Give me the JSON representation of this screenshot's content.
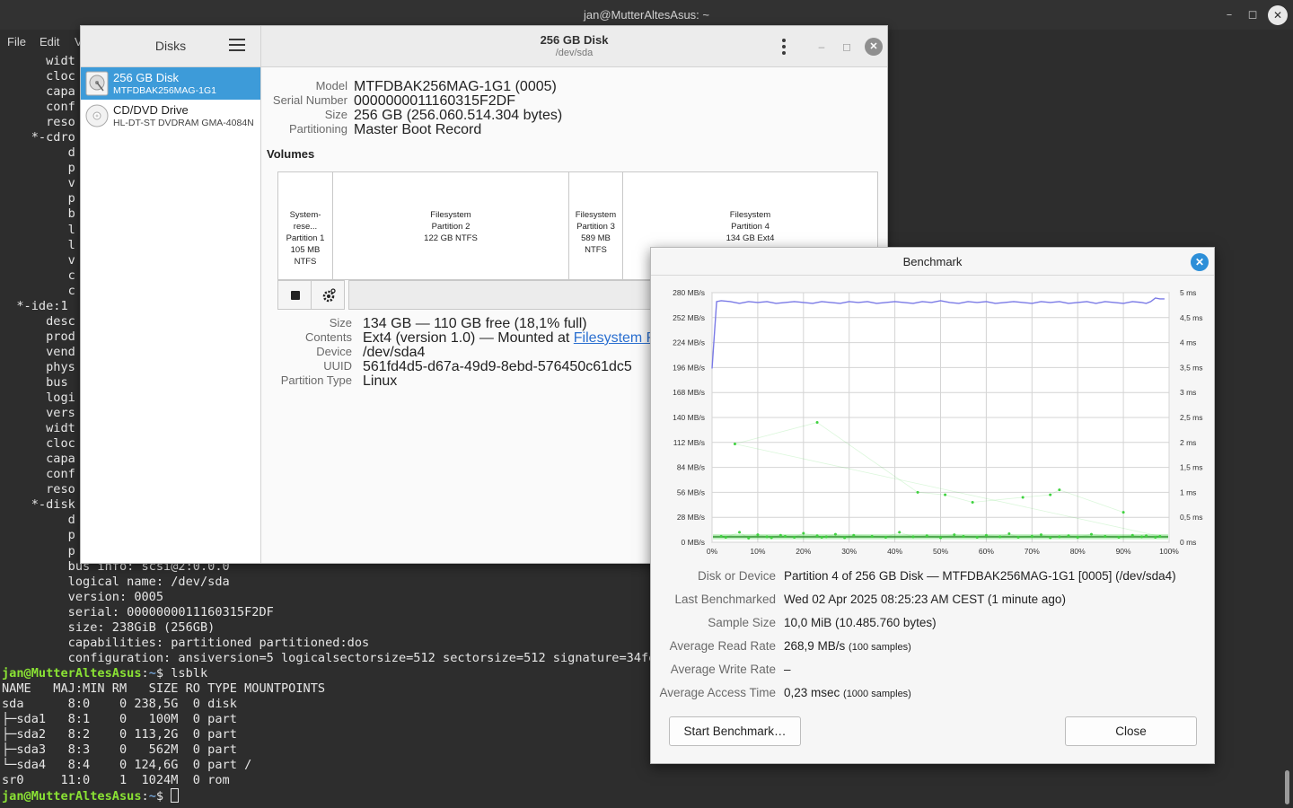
{
  "terminal": {
    "title": "jan@MutterAltesAsus: ~",
    "menu": [
      "File",
      "Edit",
      "V"
    ],
    "lines": [
      {
        "text": "      widt"
      },
      {
        "text": "      cloc"
      },
      {
        "text": "      capa"
      },
      {
        "text": "      conf"
      },
      {
        "text": "      reso"
      },
      {
        "text": "    *-cdro"
      },
      {
        "text": "         d"
      },
      {
        "text": "         p"
      },
      {
        "text": "         v"
      },
      {
        "text": "         p"
      },
      {
        "text": "         b"
      },
      {
        "text": "         l"
      },
      {
        "text": "         l"
      },
      {
        "text": "         v"
      },
      {
        "text": "         c"
      },
      {
        "text": "         c"
      },
      {
        "text": "  *-ide:1"
      },
      {
        "text": "      desc"
      },
      {
        "text": "      prod"
      },
      {
        "text": "      vend"
      },
      {
        "text": "      phys"
      },
      {
        "text": "      bus"
      },
      {
        "text": "      logi"
      },
      {
        "text": "      vers"
      },
      {
        "text": "      widt"
      },
      {
        "text": "      cloc"
      },
      {
        "text": "      capa"
      },
      {
        "text": "      conf"
      },
      {
        "text": "      reso"
      },
      {
        "text": "    *-disk"
      },
      {
        "text": "         d"
      },
      {
        "text": "         p"
      },
      {
        "text": "         p"
      },
      {
        "text": "         bus info: scsi@2:0.0.0"
      },
      {
        "text": "         logical name: /dev/sda"
      },
      {
        "text": "         version: 0005"
      },
      {
        "text": "         serial: 0000000011160315F2DF"
      },
      {
        "text": "         size: 238GiB (256GB)"
      },
      {
        "text": "         capabilities: partitioned partitioned:dos"
      },
      {
        "text": "         configuration: ansiversion=5 logicalsectorsize=512 sectorsize=512 signature=34fe3"
      },
      {
        "user": "jan@MutterAltesAsus",
        "path": "~",
        "cmd": "$ lsblk"
      },
      {
        "text": "NAME   MAJ:MIN RM   SIZE RO TYPE MOUNTPOINTS"
      },
      {
        "text": "sda      8:0    0 238,5G  0 disk"
      },
      {
        "text": "├─sda1   8:1    0   100M  0 part"
      },
      {
        "text": "├─sda2   8:2    0 113,2G  0 part"
      },
      {
        "text": "├─sda3   8:3    0   562M  0 part"
      },
      {
        "text": "└─sda4   8:4    0 124,6G  0 part /"
      },
      {
        "text": "sr0     11:0    1  1024M  0 rom"
      },
      {
        "user": "jan@MutterAltesAsus",
        "path": "~",
        "cmd": "$ ",
        "cursor": true
      }
    ]
  },
  "disks": {
    "sidebar_title": "Disks",
    "drives": [
      {
        "name": "256 GB Disk",
        "sub": "MTFDBAK256MAG-1G1",
        "selected": true
      },
      {
        "name": "CD/DVD Drive",
        "sub": "HL-DT-ST DVDRAM GMA-4084N",
        "selected": false
      }
    ],
    "title": "256 GB Disk",
    "subtitle": "/dev/sda",
    "props": [
      {
        "label": "Model",
        "value": "MTFDBAK256MAG-1G1 (0005)"
      },
      {
        "label": "Serial Number",
        "value": "0000000011160315F2DF"
      },
      {
        "label": "Size",
        "value": "256 GB (256.060.514.304 bytes)"
      },
      {
        "label": "Partitioning",
        "value": "Master Boot Record"
      }
    ],
    "volumes_label": "Volumes",
    "volumes": [
      {
        "l1": "System-rese...",
        "l2": "Partition 1",
        "l3": "105 MB NTFS"
      },
      {
        "l1": "Filesystem",
        "l2": "Partition 2",
        "l3": "122 GB NTFS"
      },
      {
        "l1": "Filesystem",
        "l2": "Partition 3",
        "l3": "589 MB NTFS"
      },
      {
        "l1": "Filesystem",
        "l2": "Partition 4",
        "l3": "134 GB Ext4"
      }
    ],
    "part_props": {
      "size_label": "Size",
      "size": "134 GB — 110 GB free (18,1% full)",
      "contents_label": "Contents",
      "contents": "Ext4 (version 1.0) — Mounted at ",
      "contents_link": "Filesystem Root",
      "device_label": "Device",
      "device": "/dev/sda4",
      "uuid_label": "UUID",
      "uuid": "561fd4d5-d67a-49d9-8ebd-576450c61dc5",
      "ptype_label": "Partition Type",
      "ptype": "Linux"
    }
  },
  "benchmark": {
    "title": "Benchmark",
    "stats": [
      {
        "label": "Disk or Device",
        "value": "Partition 4 of 256 GB Disk — MTFDBAK256MAG-1G1 [0005] (/dev/sda4)",
        "note": ""
      },
      {
        "label": "Last Benchmarked",
        "value": "Wed 02 Apr 2025 08:25:23 AM CEST (1 minute ago)",
        "note": ""
      },
      {
        "label": "Sample Size",
        "value": "10,0 MiB (10.485.760 bytes)",
        "note": ""
      },
      {
        "label": "Average Read Rate",
        "value": "268,9 MB/s ",
        "note": "(100 samples)"
      },
      {
        "label": "Average Write Rate",
        "value": "–",
        "note": ""
      },
      {
        "label": "Average Access Time",
        "value": "0,23 msec ",
        "note": "(1000 samples)"
      }
    ],
    "start_button": "Start Benchmark…",
    "close_button": "Close",
    "colors": {
      "read": "#7a7ae6",
      "access": "#3fd23f"
    }
  },
  "chart_data": {
    "type": "line",
    "x_ticks": [
      "0%",
      "10%",
      "20%",
      "30%",
      "40%",
      "50%",
      "60%",
      "70%",
      "80%",
      "90%",
      "100%"
    ],
    "y_left_ticks": [
      "0 MB/s",
      "28 MB/s",
      "56 MB/s",
      "84 MB/s",
      "112 MB/s",
      "140 MB/s",
      "168 MB/s",
      "196 MB/s",
      "224 MB/s",
      "252 MB/s",
      "280 MB/s"
    ],
    "y_right_ticks": [
      "0 ms",
      "0,5 ms",
      "1 ms",
      "1,5 ms",
      "2 ms",
      "2,5 ms",
      "3 ms",
      "3,5 ms",
      "4 ms",
      "4,5 ms",
      "5 ms"
    ],
    "ylim_left": [
      0,
      280
    ],
    "ylim_right": [
      0,
      5
    ],
    "grid": true,
    "series": [
      {
        "x": [
          0,
          1,
          2,
          4,
          6,
          8,
          10,
          12,
          14,
          16,
          18,
          20,
          22,
          24,
          26,
          28,
          30,
          32,
          34,
          36,
          38,
          40,
          42,
          44,
          46,
          48,
          50,
          52,
          54,
          56,
          58,
          60,
          62,
          64,
          66,
          68,
          70,
          72,
          74,
          76,
          78,
          80,
          82,
          84,
          86,
          88,
          90,
          92,
          94,
          95,
          96,
          97,
          98,
          99
        ],
        "values": [
          195,
          270,
          271,
          270,
          268,
          270,
          269,
          270,
          268,
          269,
          270,
          269,
          268,
          270,
          269,
          268,
          270,
          269,
          270,
          268,
          269,
          270,
          269,
          268,
          270,
          269,
          271,
          269,
          268,
          270,
          269,
          270,
          268,
          269,
          270,
          269,
          268,
          270,
          269,
          270,
          268,
          269,
          270,
          268,
          270,
          269,
          268,
          270,
          269,
          268,
          270,
          274,
          273,
          273
        ]
      },
      {
        "x": [
          2,
          3,
          6,
          8,
          10,
          12,
          13,
          15,
          16,
          18,
          20,
          23,
          24,
          25,
          27,
          29,
          31,
          35,
          38,
          41,
          44,
          47,
          50,
          53,
          55,
          58,
          60,
          63,
          65,
          67,
          70,
          72,
          74,
          76,
          78,
          80,
          83,
          86,
          89,
          92,
          94,
          95,
          97,
          98,
          5,
          23,
          45,
          51,
          57,
          68,
          74,
          76,
          90
        ],
        "values": [
          0.12,
          0.1,
          0.2,
          0.08,
          0.15,
          0.11,
          0.09,
          0.14,
          0.12,
          0.1,
          0.18,
          0.13,
          0.1,
          0.11,
          0.16,
          0.09,
          0.14,
          0.12,
          0.1,
          0.2,
          0.11,
          0.13,
          0.09,
          0.15,
          0.12,
          0.1,
          0.14,
          0.11,
          0.17,
          0.1,
          0.12,
          0.15,
          0.09,
          0.11,
          0.13,
          0.1,
          0.16,
          0.12,
          0.1,
          0.14,
          0.11,
          0.13,
          0.1,
          0.12,
          1.97,
          2.4,
          1.0,
          0.95,
          0.8,
          0.9,
          0.95,
          1.05,
          0.6
        ]
      }
    ]
  }
}
